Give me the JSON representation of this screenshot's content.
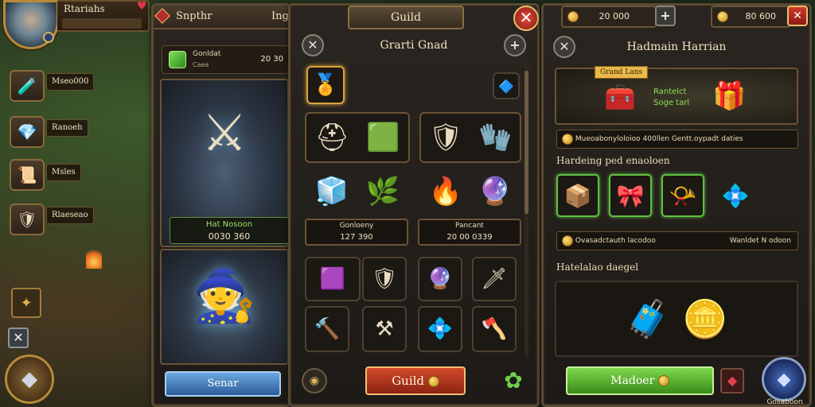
{
  "player": {
    "name": "Rtariahs"
  },
  "sidebar": {
    "items": [
      {
        "label": "Mseo000",
        "icon": "potion-icon"
      },
      {
        "label": "Ranoeh",
        "icon": "gem-icon"
      },
      {
        "label": "Msles",
        "icon": "scroll-icon"
      },
      {
        "label": "Rlaeseao",
        "icon": "shield-icon"
      }
    ]
  },
  "hero_panel": {
    "title": "Snpthr",
    "title_suffix": "Ing",
    "currency": {
      "label": "Gonldat",
      "sub": "Caea",
      "value": "20 30"
    },
    "card1": {
      "name": "Hat Nosoon",
      "value": "0030 360"
    },
    "button_label": "Senar"
  },
  "guild_panel": {
    "title": "Guild",
    "subtitle": "Grarti Gnad",
    "reward_left": {
      "label": "Gonloeny",
      "value": "127 390"
    },
    "reward_right": {
      "label": "Pancant",
      "value": "20 00 0339"
    },
    "button_label": "Guild"
  },
  "right_panel": {
    "top_left_value": "20 000",
    "top_right_value": "80 600",
    "title": "Hadmain Harrian",
    "feature": {
      "tag": "Grand Lans",
      "line1": "Rantelct",
      "line2": "Soge tarl"
    },
    "info1": "Mueoabonyloloioo 400llen Gentt.oypadt daties",
    "section1_label": "Hardeing ped enaoloen",
    "info2_left": "Ovasadctauth lacodoo",
    "info2_right": "Wanldet N odoon",
    "section2_label": "Hatelalao daegel",
    "button_label": "Madoer",
    "corner_label": "Gosaboon"
  },
  "colors": {
    "accent_gold": "#d7a43a",
    "button_red": "#d24a2a",
    "button_green": "#7ed84a",
    "button_blue": "#6aa8e0",
    "reward_green": "#9ee06a"
  }
}
